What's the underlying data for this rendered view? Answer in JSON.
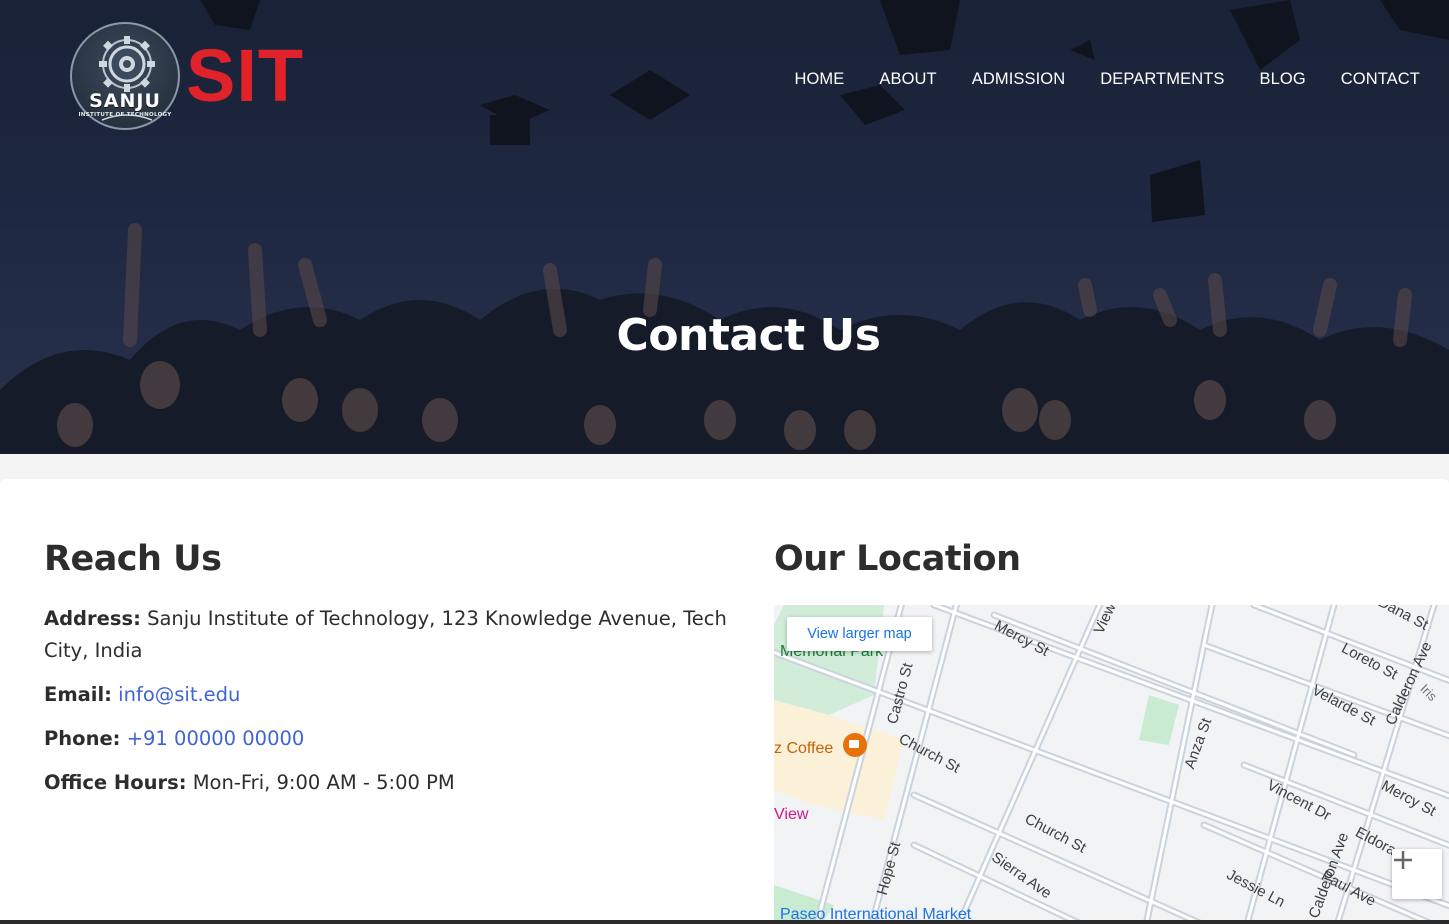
{
  "brand": {
    "logo_text": "SIT",
    "badge_name": "SANJU",
    "badge_sub": "INSTITUTE OF TECHNOLOGY",
    "accent_color": "#e0222b"
  },
  "nav": {
    "items": [
      "HOME",
      "ABOUT",
      "ADMISSION",
      "DEPARTMENTS",
      "BLOG",
      "CONTACT"
    ]
  },
  "hero": {
    "title": "Contact Us"
  },
  "reach": {
    "title": "Reach Us",
    "address_label": "Address:",
    "address_value": "Sanju Institute of Technology, 123 Knowledge Avenue, Tech City, India",
    "email_label": "Email:",
    "email_value": "info@sit.edu",
    "phone_label": "Phone:",
    "phone_value": "+91 00000 00000",
    "hours_label": "Office Hours:",
    "hours_value": "Mon-Fri, 9:00 AM - 5:00 PM"
  },
  "location": {
    "title": "Our Location",
    "view_larger": "View larger map",
    "labels": {
      "memorial_park": "Memorial Park",
      "coffee": "z Coffee",
      "view_poi": "View",
      "market": "Paseo International Market",
      "castro": "Castro St",
      "church1": "Church St",
      "church2": "Church St",
      "mercy1": "Mercy St",
      "mercy2": "Mercy St",
      "view_st": "View",
      "loreto": "Loreto St",
      "velarde": "Velarde St",
      "calderon1": "Calderon Ave",
      "calderon2": "Calderon Ave",
      "anza": "Anza St",
      "vincent": "Vincent Dr",
      "eldora": "Eldora",
      "hope": "Hope St",
      "sierra": "Sierra Ave",
      "jessie": "Jessie Ln",
      "paul": "Paul Ave",
      "dana": "Dana St",
      "iris": "Iris"
    }
  }
}
